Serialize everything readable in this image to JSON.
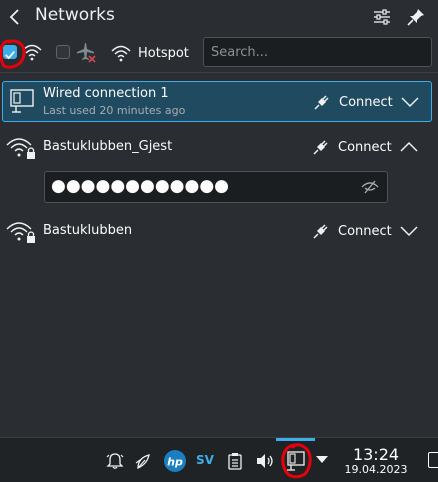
{
  "header": {
    "title": "Networks",
    "back_icon": "back-arrow-icon",
    "configure_icon": "configure-icon",
    "pin_icon": "pin-icon"
  },
  "toolbar": {
    "wifi_enabled": true,
    "airplane_mode": false,
    "hotspot_label": "Hotspot",
    "search": {
      "value": "",
      "placeholder": "Search..."
    }
  },
  "connections": [
    {
      "name": "Wired connection 1",
      "subtitle": "Last used 20 minutes ago",
      "type": "wired",
      "action_label": "Connect",
      "expanded": false,
      "selected": true
    },
    {
      "name": "Bastuklubben_Gjest",
      "type": "wifi-secured",
      "action_label": "Connect",
      "expanded": true,
      "password": "●●●●●●●●●●●●"
    },
    {
      "name": "Bastuklubben",
      "type": "wifi-secured",
      "action_label": "Connect",
      "expanded": false
    }
  ],
  "taskbar": {
    "tray_icons": [
      "notifications-icon",
      "kdeconnect-icon",
      "hp-printer-icon",
      "keyboard-layout-indicator",
      "clipboard-icon",
      "volume-icon",
      "network-wired-icon",
      "expand-tray-icon"
    ],
    "keyboard_layout": "SV",
    "clock_time": "13:24",
    "clock_date": "19.04.2023"
  },
  "colors": {
    "background": "#2a2e32",
    "accent": "#3daee9",
    "selected_row": "#1f4a60",
    "annotation": "#e8000b"
  }
}
